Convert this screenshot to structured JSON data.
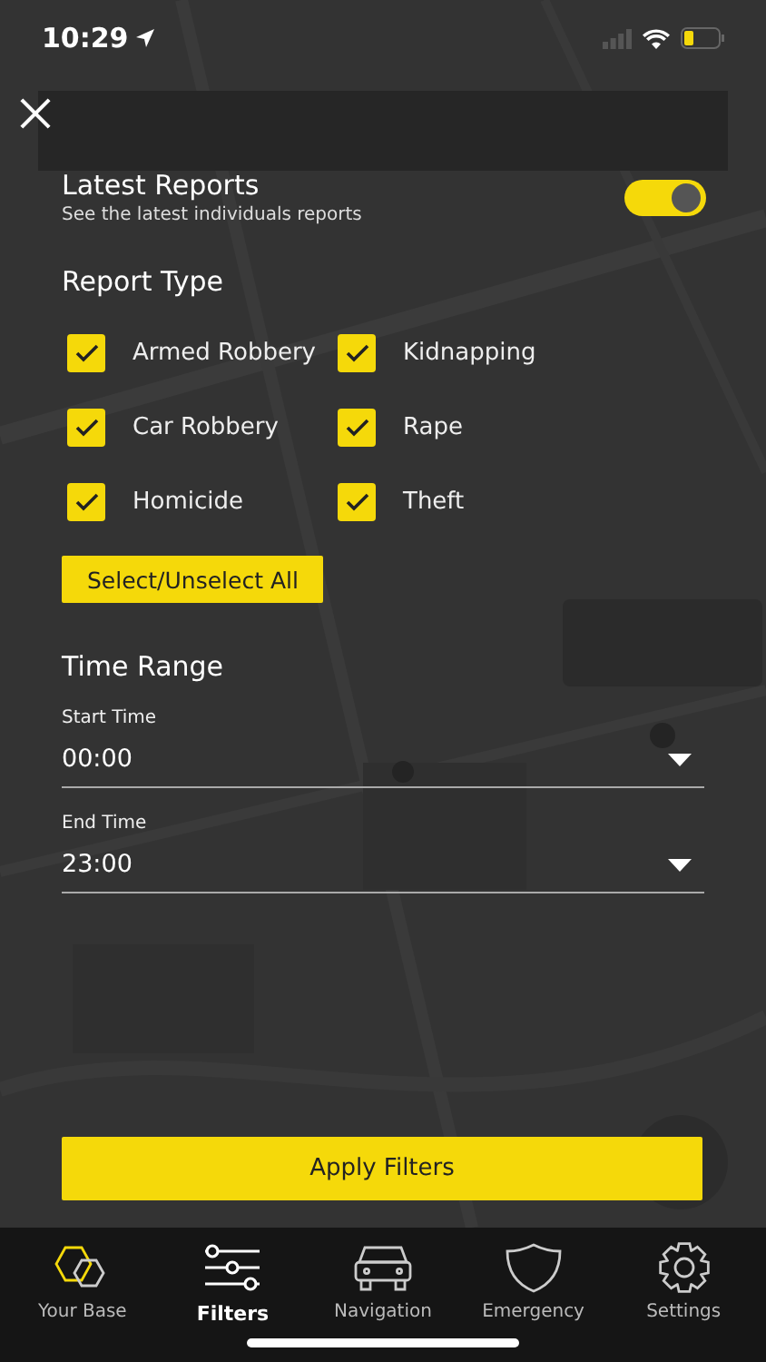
{
  "status_bar": {
    "time": "10:29"
  },
  "latest_reports": {
    "title": "Latest Reports",
    "subtitle": "See the latest individuals reports",
    "on": true
  },
  "report_type": {
    "title": "Report Type",
    "options": [
      {
        "label": "Armed Robbery",
        "checked": true
      },
      {
        "label": "Kidnapping",
        "checked": true
      },
      {
        "label": "Car Robbery",
        "checked": true
      },
      {
        "label": "Rape",
        "checked": true
      },
      {
        "label": "Homicide",
        "checked": true
      },
      {
        "label": "Theft",
        "checked": true
      }
    ],
    "select_all_button": "Select/Unselect All"
  },
  "time_range": {
    "title": "Time Range",
    "fields": [
      {
        "label": "Start Time",
        "value": "00:00"
      },
      {
        "label": "End Time",
        "value": "23:00"
      }
    ]
  },
  "apply_button": "Apply Filters",
  "tab_bar": [
    {
      "label": "Your Base",
      "selected": false
    },
    {
      "label": "Filters",
      "selected": true
    },
    {
      "label": "Navigation",
      "selected": false
    },
    {
      "label": "Emergency",
      "selected": false
    },
    {
      "label": "Settings",
      "selected": false
    }
  ]
}
